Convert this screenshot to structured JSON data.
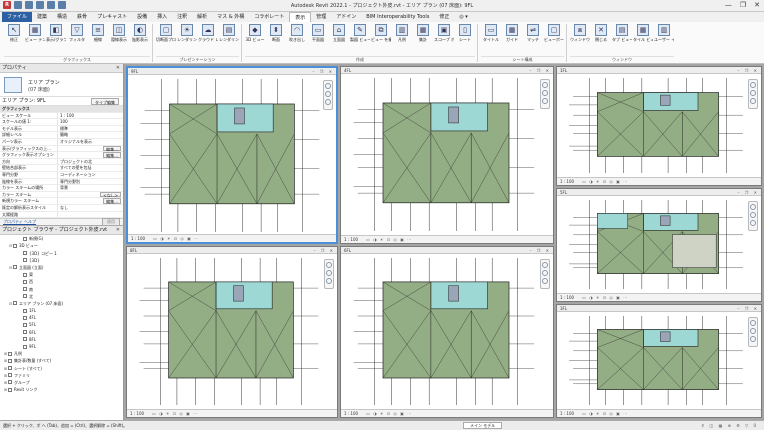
{
  "window": {
    "title": "Autodesk Revit 2022.1 - プロジェクト外皮.rvt - エリア プラン (07 床面): 9FL",
    "controls": [
      "—",
      "❐",
      "✕"
    ]
  },
  "quick_access": {
    "r_logo": "R"
  },
  "tabs": [
    "ファイル",
    "建築",
    "構造",
    "鉄骨",
    "プレキャスト",
    "設備",
    "挿入",
    "注釈",
    "解析",
    "マス & 外構",
    "コラボレート",
    "表示",
    "管理",
    "アドイン",
    "BIM Interoperability Tools",
    "修正",
    "◎ ▾"
  ],
  "ribbon": {
    "tools": [
      "修正",
      "ビュー テンプレート",
      "表示/グラフィックス",
      "フィルタ",
      "細線",
      "隠線表示",
      "陰影表示",
      "切断面プロファイル",
      "レンダリング",
      "クラウド レンダリング",
      "レンダリング ギャラリー",
      "3D ビュー",
      "断面",
      "吹き出し",
      "平面図",
      "立面図",
      "製図 ビュー",
      "ビュー を複製",
      "凡例",
      "集計",
      "スコープ ボックス",
      "シート",
      "タイトル",
      "ガイド",
      "マッチ",
      "ビューポート",
      "ウィンドウを切り替え",
      "閉じる",
      "タブ ビュー",
      "タイル ビュー",
      "ユーザー インターフェース"
    ],
    "groups": [
      "グラフィックス",
      "プレゼンテーション",
      "作成",
      "シート構成",
      "ウィンドウ"
    ]
  },
  "properties": {
    "header": "プロパティ",
    "type_name": "エリア プラン",
    "type_sub": "(07 床面)",
    "instance": "エリア プラン: 9FL",
    "type_edit": "タイプ編集",
    "rows": [
      {
        "k": "グラフィックス",
        "v": "",
        "cat": true
      },
      {
        "k": "ビュー スケール",
        "v": "1 : 100"
      },
      {
        "k": "スケールの値 1:",
        "v": "100"
      },
      {
        "k": "モデル表示",
        "v": "標準"
      },
      {
        "k": "詳細レベル",
        "v": "簡略"
      },
      {
        "k": "パーツ表示",
        "v": "オリジナルを表示"
      },
      {
        "k": "表示/グラフィックスの上...",
        "v": "編集...",
        "btn": true
      },
      {
        "k": "グラフィック表示オプション",
        "v": "編集...",
        "btn": true
      },
      {
        "k": "方向",
        "v": "プロジェクトの北"
      },
      {
        "k": "壁結合部表示",
        "v": "すべての壁を包括"
      },
      {
        "k": "専門分野",
        "v": "コーディネーション"
      },
      {
        "k": "陰線を表示",
        "v": "専門分野別"
      },
      {
        "k": "カラー スキームの場所",
        "v": "背景"
      },
      {
        "k": "カラー スキーム",
        "v": "<なし>",
        "btn": true
      },
      {
        "k": "新規カラー スキーム",
        "v": "編集...",
        "btn": true
      },
      {
        "k": "既定の解析表示スタイル",
        "v": "なし"
      },
      {
        "k": "太陽経路",
        "v": ""
      }
    ],
    "help": "プロパティ ヘルプ",
    "apply": "適用"
  },
  "browser": {
    "header": "プロジェクト ブラウザ - プロジェクト外皮.rvt",
    "items": [
      {
        "label": "新規(G)",
        "indent": 3,
        "toggle": ""
      },
      {
        "label": "3D ビュー",
        "indent": 1,
        "toggle": "⊟"
      },
      {
        "label": "{3D} コピー 1",
        "indent": 3,
        "toggle": ""
      },
      {
        "label": "{3D}",
        "indent": 3,
        "toggle": ""
      },
      {
        "label": "立面図 (立面)",
        "indent": 1,
        "toggle": "⊟"
      },
      {
        "label": "東",
        "indent": 3,
        "toggle": ""
      },
      {
        "label": "西",
        "indent": 3,
        "toggle": ""
      },
      {
        "label": "南",
        "indent": 3,
        "toggle": ""
      },
      {
        "label": "北",
        "indent": 3,
        "toggle": ""
      },
      {
        "label": "エリア プラン (07 床面)",
        "indent": 1,
        "toggle": "⊟"
      },
      {
        "label": "1FL",
        "indent": 3,
        "toggle": ""
      },
      {
        "label": "4FL",
        "indent": 3,
        "toggle": ""
      },
      {
        "label": "5FL",
        "indent": 3,
        "toggle": ""
      },
      {
        "label": "6FL",
        "indent": 3,
        "toggle": ""
      },
      {
        "label": "8FL",
        "indent": 3,
        "toggle": ""
      },
      {
        "label": "9FL",
        "indent": 3,
        "toggle": ""
      },
      {
        "label": "凡例",
        "indent": 0,
        "toggle": "⊞"
      },
      {
        "label": "集計表/数量 (すべて)",
        "indent": 0,
        "toggle": "⊞"
      },
      {
        "label": "シート (すべて)",
        "indent": 0,
        "toggle": "⊞"
      },
      {
        "label": "ファミリ",
        "indent": 0,
        "toggle": "⊞"
      },
      {
        "label": "グループ",
        "indent": 0,
        "toggle": "⊞"
      },
      {
        "label": "Revit リンク",
        "indent": 0,
        "toggle": "⊞"
      }
    ]
  },
  "views": [
    {
      "title": "9FL",
      "scale": "1 : 100",
      "controls": "▭ ◑ ☀ ⊡ ◎ ▣ ⋯"
    },
    {
      "title": "4FL",
      "scale": "1 : 100",
      "controls": "▭ ◑ ☀ ⊡ ◎ ▣ ⋯"
    },
    {
      "title": "1FL",
      "scale": "1 : 100",
      "controls": "▭ ◑ ☀ ⊡ ◎ ▣ ⋯"
    },
    {
      "title": "5FL",
      "scale": "1 : 100",
      "controls": "▭ ◑ ☀ ⊡ ◎ ▣ ⋯"
    },
    {
      "title": "8FL",
      "scale": "1 : 100",
      "controls": "▭ ◑ ☀ ⊡ ◎ ▣ ⋯"
    },
    {
      "title": "6FL",
      "scale": "1 : 100",
      "controls": "▭ ◑ ☀ ⊡ ◎ ▣ ⋯"
    },
    {
      "title": "3FL",
      "scale": "1 : 100",
      "controls": "▭ ◑ ☀ ⊡ ◎ ▣ ⋯"
    }
  ],
  "view_header_controls": "– ❐ ✕",
  "status": {
    "text": "選択 + クリック、ボ ヘ (Tab)、追加 = (Ctrl)、選択解除 = (Shift)。",
    "model": "メイン モデル",
    "icons": "⚲ ◫ ▦ ⊕ ⚙ ▽ 0"
  },
  "colors": {
    "green": "#93ad84",
    "cyan": "#9dd8d4",
    "active_border": "#4a90d9",
    "file_tab": "#2d5fa3"
  }
}
